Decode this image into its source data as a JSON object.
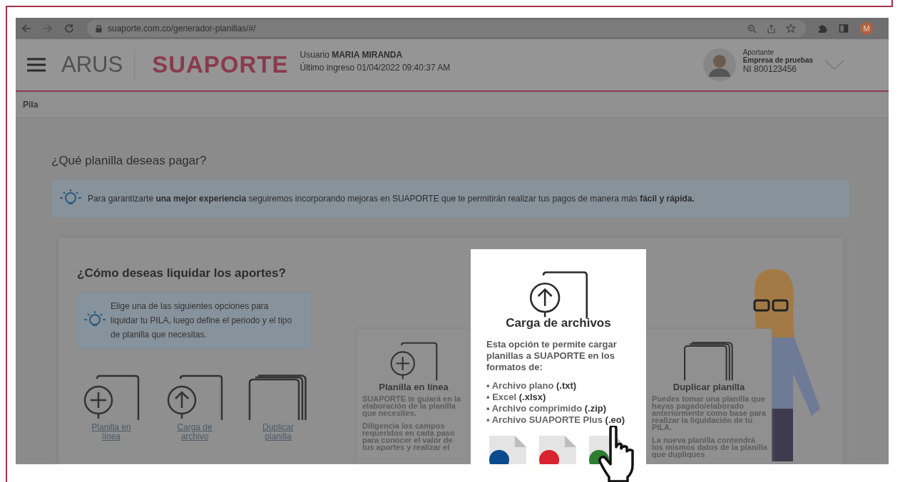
{
  "browser": {
    "url": "suaporte.com.co/generador-planillas/#/",
    "profile_initial": "M"
  },
  "header": {
    "brand": "ARUS",
    "product": "SUAPORTE",
    "user_label": "Usuario",
    "user_name": "MARIA MIRANDA",
    "last_login": "Último ingreso 01/04/2022 09:40:37 AM",
    "account_role": "Aportante",
    "account_company": "Empresa de pruebas",
    "account_id": "NI 800123456"
  },
  "breadcrumb": "Pila",
  "page_title": "¿Qué planilla deseas pagar?",
  "notice": "Para garantizarte **una mejor experiencia** seguiremos incorporando mejoras en SUAPORTE que te permitirán realizar tus pagos de manera más **fácil y rápida.**",
  "section": {
    "title": "¿Cómo deseas liquidar los aportes?",
    "hint": "Elige una de las siguientes opciones para liquidar tu PILA, luego define el periodo y el tipo de planilla que necesitas.",
    "options": [
      {
        "kind": "new",
        "label": "Planilla en línea"
      },
      {
        "kind": "upload",
        "label": "Carga de archivo"
      },
      {
        "kind": "duplicate",
        "label": "Duplicar planilla"
      }
    ]
  },
  "cards": [
    {
      "kind": "new",
      "highlighted": false,
      "title": "Planilla en línea",
      "paragraphs": [
        "SUAPORTE te guiará en la elaboración de la planilla que necesites.",
        "Diligencia los campos requeridos en cada paso para conocer el valor de tus aportes y realizar el"
      ]
    },
    {
      "kind": "upload",
      "highlighted": true,
      "title": "Carga de archivos",
      "paragraphs": [
        "Esta opción te permite cargar planillas a SUAPORTE en los formatos de:"
      ],
      "formats": [
        "• Archivo plano **(.txt)**",
        "• Excel **(.xlsx)**",
        "• Archivo comprimido **(.zip)**",
        "• Archivo SUAPORTE Plus **(.eo)**"
      ],
      "file_icons": [
        {
          "color": "#0b4a8c"
        },
        {
          "color": "#d9232e"
        },
        {
          "color": "#2e7d32"
        }
      ]
    },
    {
      "kind": "duplicate",
      "highlighted": false,
      "title": "Duplicar planilla",
      "paragraphs": [
        "Puedes tomar una planilla que hayas pagado/elaborado anteriormente como base para realizar la liquidación de tu PILA.",
        "La nueva planilla contendrá los mismos datos de la planilla que dupliques"
      ]
    }
  ]
}
